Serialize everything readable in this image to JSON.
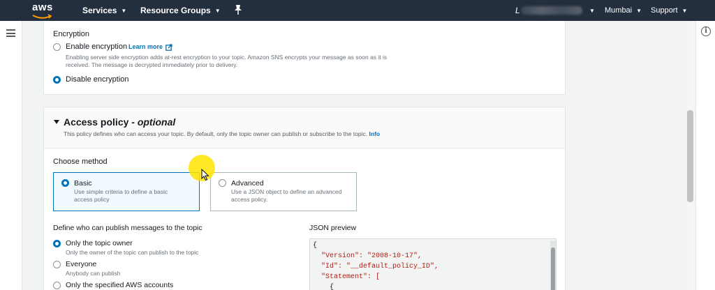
{
  "topnav": {
    "logo_text": "aws",
    "services": "Services",
    "resource_groups": "Resource Groups",
    "account_initial": "L",
    "region": "Mumbai",
    "support": "Support"
  },
  "encryption": {
    "heading": "Encryption",
    "enable_label": "Enable encryption",
    "learn_more": "Learn more",
    "enable_desc_line1": "Enabling server side encryption adds at-rest encryption to your topic. Amazon SNS encrypts your message as soon as it is",
    "enable_desc_line2": "received. The message is decrypted immediately prior to delivery.",
    "disable_label": "Disable encryption",
    "selected": "disable"
  },
  "access_policy": {
    "title": "Access policy - ",
    "title_optional": "optional",
    "description": "This policy defines who can access your topic. By default, only the topic owner can publish or subscribe to the topic.",
    "info_link": "Info",
    "choose_method_label": "Choose method",
    "methods": [
      {
        "label": "Basic",
        "desc_line1": "Use simple criteria to define a basic",
        "desc_line2": "access policy",
        "selected": true
      },
      {
        "label": "Advanced",
        "desc_line1": "Use a JSON object to define an advanced",
        "desc_line2": "access policy.",
        "selected": false
      }
    ],
    "publish_label": "Define who can publish messages to the topic",
    "publish_options": [
      {
        "label": "Only the topic owner",
        "desc": "Only the owner of the topic can publish to the topic",
        "selected": true
      },
      {
        "label": "Everyone",
        "desc": "Anybody can publish",
        "selected": false
      },
      {
        "label": "Only the specified AWS accounts",
        "desc": "",
        "selected": false
      }
    ],
    "json_preview_label": "JSON preview",
    "json_lines": [
      {
        "indent": "",
        "key": "{",
        "val": ""
      },
      {
        "indent": "  ",
        "key": "\"Version\": ",
        "val": "\"2008-10-17\","
      },
      {
        "indent": "  ",
        "key": "\"Id\": ",
        "val": "\"__default_policy_ID\","
      },
      {
        "indent": "  ",
        "key": "\"Statement\": [",
        "val": ""
      },
      {
        "indent": "    ",
        "key": "{",
        "val": ""
      }
    ]
  },
  "colors": {
    "nav_bg": "#232f3e",
    "link": "#0073bb",
    "selected_tile_bg": "#f1faff",
    "cursor_highlight": "#ffe400"
  },
  "icons": {
    "menu": "hamburger-icon",
    "info": "info-icon",
    "pin": "pin-icon",
    "external": "external-link-icon"
  }
}
